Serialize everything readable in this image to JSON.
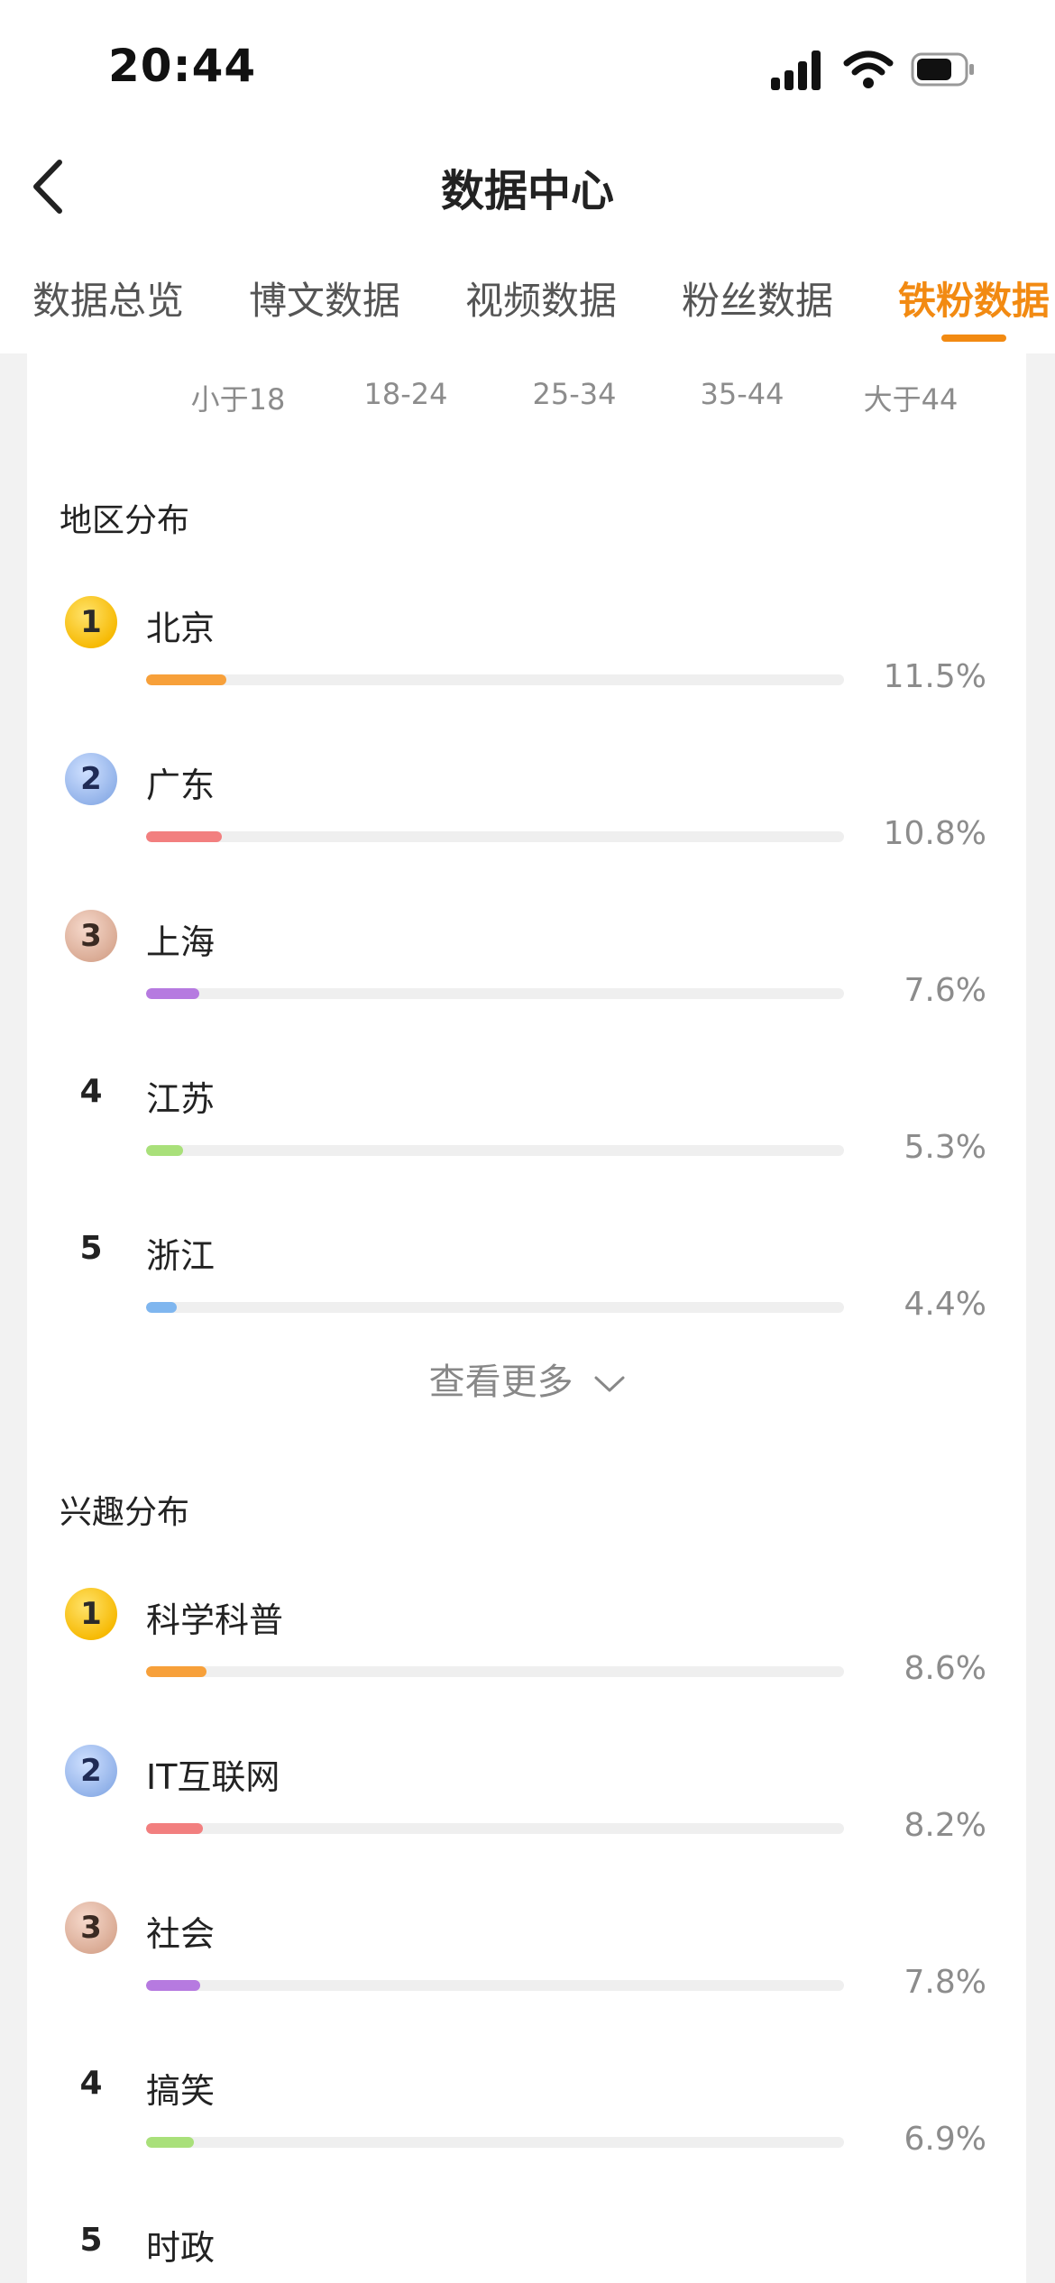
{
  "status_bar": {
    "time": "20:44",
    "icons": [
      "signal-icon",
      "wifi-icon",
      "battery-icon"
    ]
  },
  "nav": {
    "title": "数据中心",
    "back_icon": "chevron-left-icon"
  },
  "tabs": [
    {
      "label": "数据总览",
      "active": false
    },
    {
      "label": "博文数据",
      "active": false
    },
    {
      "label": "视频数据",
      "active": false
    },
    {
      "label": "粉丝数据",
      "active": false
    },
    {
      "label": "铁粉数据",
      "active": true
    }
  ],
  "age_groups": [
    "小于18",
    "18-24",
    "25-34",
    "35-44",
    "大于44"
  ],
  "region": {
    "title": "地区分布",
    "items": [
      {
        "rank": "1",
        "name": "北京",
        "pct": "11.5%",
        "value": 11.5,
        "color": "#f7a03a"
      },
      {
        "rank": "2",
        "name": "广东",
        "pct": "10.8%",
        "value": 10.8,
        "color": "#f27f7f"
      },
      {
        "rank": "3",
        "name": "上海",
        "pct": "7.6%",
        "value": 7.6,
        "color": "#b67ae0"
      },
      {
        "rank": "4",
        "name": "江苏",
        "pct": "5.3%",
        "value": 5.3,
        "color": "#a9e07a"
      },
      {
        "rank": "5",
        "name": "浙江",
        "pct": "4.4%",
        "value": 4.4,
        "color": "#7fb6ef"
      }
    ],
    "more_label": "查看更多"
  },
  "interest": {
    "title": "兴趣分布",
    "items": [
      {
        "rank": "1",
        "name": "科学科普",
        "pct": "8.6%",
        "value": 8.6,
        "color": "#f7a03a"
      },
      {
        "rank": "2",
        "name": "IT互联网",
        "pct": "8.2%",
        "value": 8.2,
        "color": "#f27f7f"
      },
      {
        "rank": "3",
        "name": "社会",
        "pct": "7.8%",
        "value": 7.8,
        "color": "#b67ae0"
      },
      {
        "rank": "4",
        "name": "搞笑",
        "pct": "6.9%",
        "value": 6.9,
        "color": "#a9e07a"
      },
      {
        "rank": "5",
        "name": "时政",
        "pct": "",
        "value": null,
        "color": "#7fb6ef"
      }
    ]
  },
  "theme": {
    "accent": "#f28a12"
  }
}
